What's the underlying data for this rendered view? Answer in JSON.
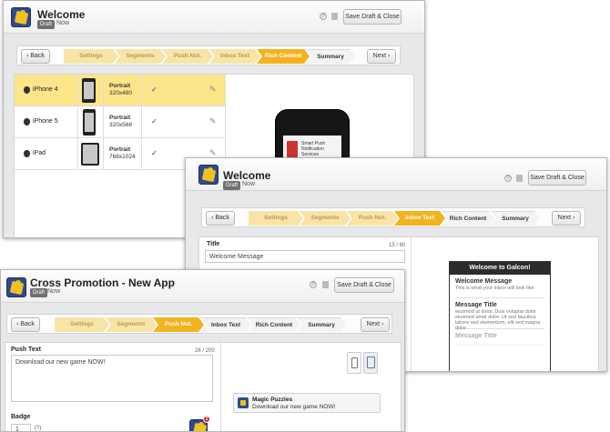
{
  "windows": {
    "welcome_rich": {
      "title": "Welcome",
      "draft_badge": "Draft",
      "status": "Now",
      "help_icon": "?",
      "save_label": "Save Draft & Close",
      "back_label": "Back",
      "next_label": "Next",
      "steps": [
        {
          "label": "Settings",
          "state": "done"
        },
        {
          "label": "Segments",
          "state": "done"
        },
        {
          "label": "Push Not.",
          "state": "done"
        },
        {
          "label": "Inbox Text",
          "state": "done"
        },
        {
          "label": "Rich Content",
          "state": "current"
        },
        {
          "label": "Summary",
          "state": "todo"
        }
      ],
      "devices": [
        {
          "name": "iPhone 4",
          "orientation": "Portrait",
          "resolution": "320x480",
          "selected": true
        },
        {
          "name": "iPhone 5",
          "orientation": "Portrait",
          "resolution": "320x568",
          "selected": false
        },
        {
          "name": "iPad",
          "orientation": "Portrait",
          "resolution": "768x1024",
          "selected": false
        }
      ],
      "preview_caption": "Smart Push Notification Services"
    },
    "welcome_inbox": {
      "title": "Welcome",
      "draft_badge": "Draft",
      "status": "Now",
      "help_icon": "?",
      "save_label": "Save Draft & Close",
      "back_label": "Back",
      "next_label": "Next",
      "steps": [
        {
          "label": "Settings",
          "state": "done"
        },
        {
          "label": "Segments",
          "state": "done"
        },
        {
          "label": "Push Not.",
          "state": "done"
        },
        {
          "label": "Inbox Text",
          "state": "current"
        },
        {
          "label": "Rich Content",
          "state": "todo"
        },
        {
          "label": "Summary",
          "state": "todo"
        }
      ],
      "title_field_label": "Title",
      "title_counter": "15 / 80",
      "title_value": "Welcome Message",
      "preview_header": "Welcome to Galcon!",
      "preview_msg1_title": "Welcome Message",
      "preview_msg1_sub": "This is what your inbox will look like",
      "preview_msg2_title": "Message Title",
      "preview_msg2_sub": "eiusmod ut dolor. Duis voluptat dolor eiusmod amet dolor. Ut sed faucibus labore sed elementum, elit sed magna dolor",
      "preview_msg3_title": "Message Title"
    },
    "cross_promo": {
      "title": "Cross Promotion - New App",
      "draft_badge": "Draft",
      "status": "Now",
      "help_icon": "?",
      "save_label": "Save Draft & Close",
      "back_label": "Back",
      "next_label": "Next",
      "steps": [
        {
          "label": "Settings",
          "state": "done"
        },
        {
          "label": "Segments",
          "state": "done"
        },
        {
          "label": "Push Not.",
          "state": "current"
        },
        {
          "label": "Inbox Text",
          "state": "todo"
        },
        {
          "label": "Rich Content",
          "state": "todo"
        },
        {
          "label": "Summary",
          "state": "todo"
        }
      ],
      "push_text_label": "Push Text",
      "push_counter": "26 / 200",
      "push_value": "Download our new game NOW!",
      "badge_label": "Badge",
      "badge_value": "1",
      "badge_help": "(?)",
      "notif_app": "Magic Puzzles",
      "notif_body": "Download our new game NOW!",
      "app_badge_count": "1"
    }
  },
  "colors": {
    "step_current": "#f2b31e",
    "step_done": "#f9e4a8",
    "selected_row": "#fde58a",
    "app_icon": "#2c4a92"
  }
}
